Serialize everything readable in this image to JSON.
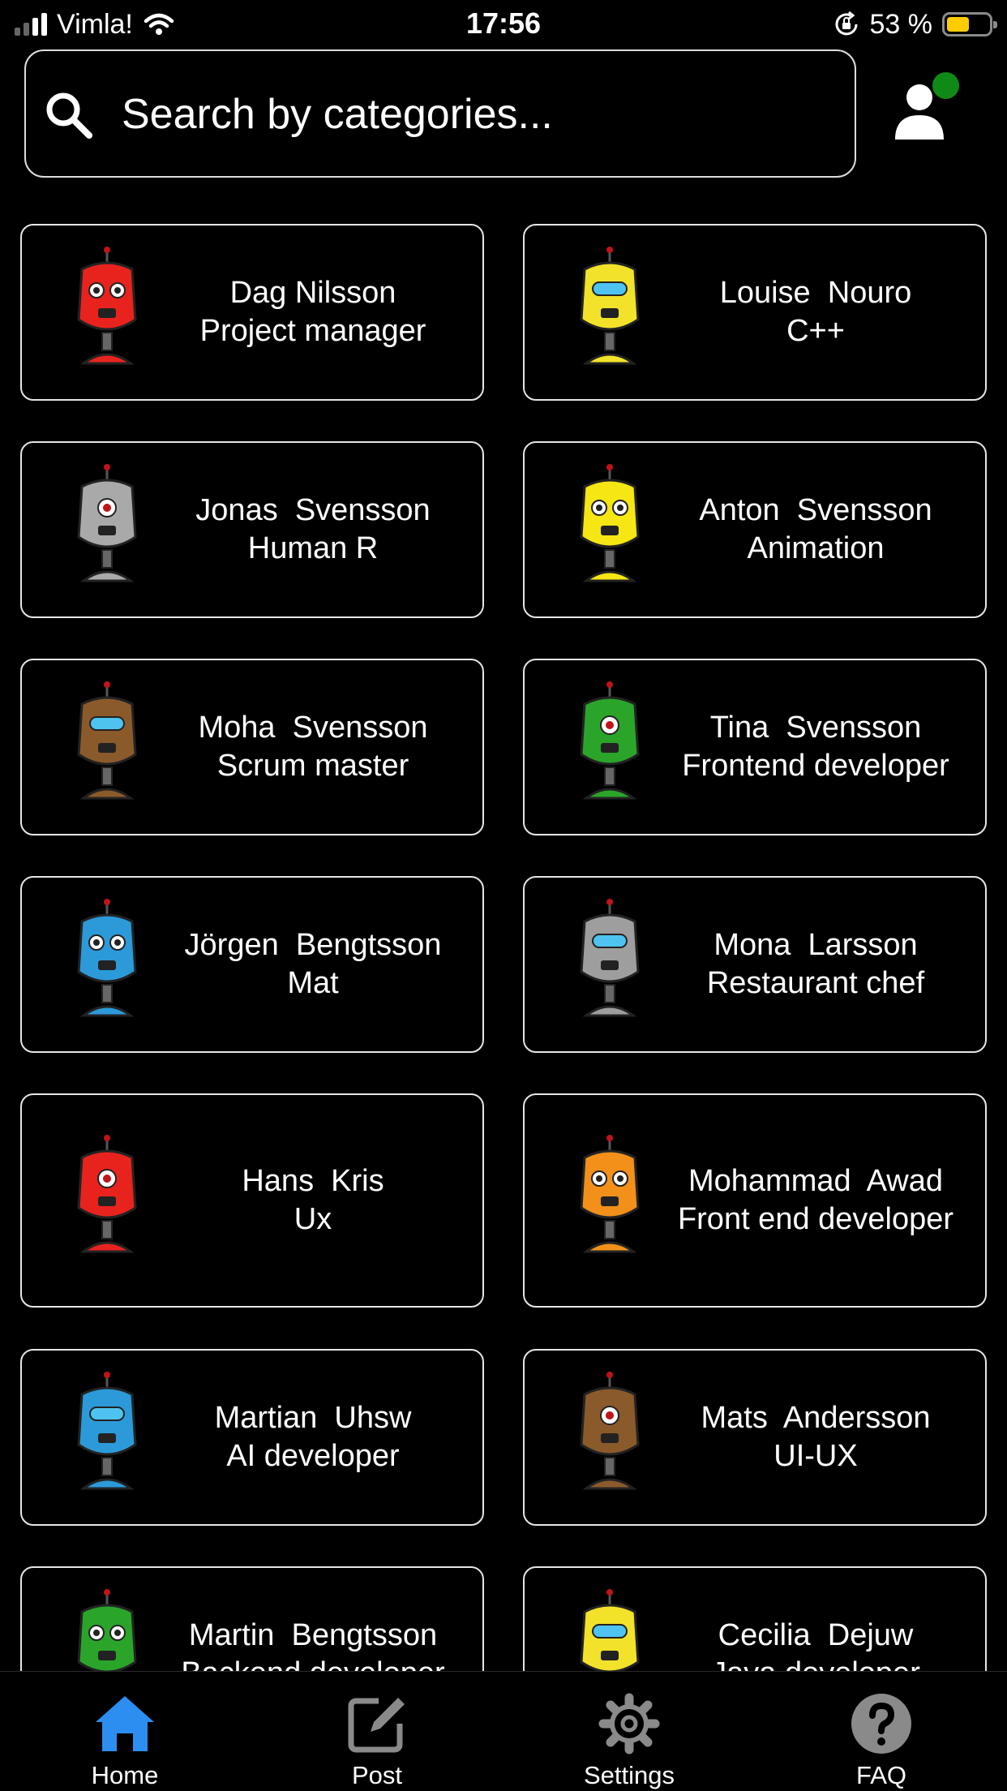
{
  "status_bar": {
    "carrier": "Vimla!",
    "time": "17:56",
    "battery_text": "53 %",
    "battery_level": 0.53,
    "signal_bars_active": 2,
    "signal_bars_total": 4,
    "icons": [
      "signal-icon",
      "wifi-icon",
      "orientation-lock-icon",
      "battery-icon"
    ]
  },
  "search": {
    "placeholder": "Search by categories...",
    "value": ""
  },
  "profile": {
    "icon": "user-icon",
    "status_dot_color": "#0f8a16"
  },
  "people": [
    {
      "name": "Dag Nilsson",
      "role": "Project manager",
      "robot_color": "#e8231e"
    },
    {
      "name": "Louise  Nouro",
      "role": "C++",
      "robot_color": "#f2e22a"
    },
    {
      "name": "Jonas  Svensson",
      "role": "Human R",
      "robot_color": "#a9a9a9"
    },
    {
      "name": "Anton  Svensson",
      "role": "Animation",
      "robot_color": "#f5e614"
    },
    {
      "name": "Moha  Svensson",
      "role": "Scrum master",
      "robot_color": "#8b5a2b"
    },
    {
      "name": "Tina  Svensson",
      "role": "Frontend developer",
      "robot_color": "#2aa52a"
    },
    {
      "name": "Jörgen  Bengtsson",
      "role": "Mat",
      "robot_color": "#2c9ad8"
    },
    {
      "name": "Mona  Larsson",
      "role": "Restaurant chef",
      "robot_color": "#9e9e9e"
    },
    {
      "name": "Hans  Kris",
      "role": "Ux",
      "robot_color": "#e8231e"
    },
    {
      "name": "Mohammad  Awad",
      "role": "Front end developer",
      "robot_color": "#f2901a"
    },
    {
      "name": "Martian  Uhsw",
      "role": "AI developer",
      "robot_color": "#2c9ad8"
    },
    {
      "name": "Mats  Andersson",
      "role": "UI-UX",
      "robot_color": "#8b5a2b"
    },
    {
      "name": "Martin  Bengtsson",
      "role": "Backend developer",
      "robot_color": "#2aa52a"
    },
    {
      "name": "Cecilia  Dejuw",
      "role": "Java developer",
      "robot_color": "#f2e22a"
    }
  ],
  "tabs": [
    {
      "label": "Home",
      "icon": "home-icon",
      "active": true,
      "color": "#2b8ef0"
    },
    {
      "label": "Post",
      "icon": "edit-icon",
      "active": false,
      "color": "#8a8a8a"
    },
    {
      "label": "Settings",
      "icon": "gear-icon",
      "active": false,
      "color": "#8a8a8a"
    },
    {
      "label": "FAQ",
      "icon": "help-icon",
      "active": false,
      "color": "#8a8a8a"
    }
  ]
}
